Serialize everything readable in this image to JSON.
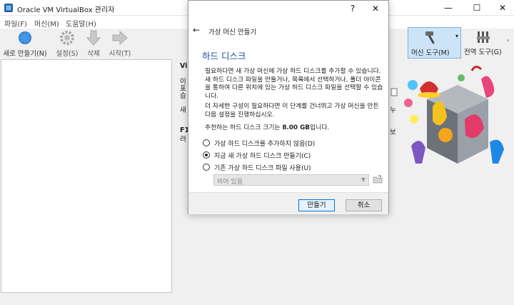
{
  "app": {
    "title": "Oracle VM VirtualBox 관리자"
  },
  "menu": [
    "파일(F)",
    "머신(M)",
    "도움말(H)"
  ],
  "toolbar": {
    "new_label": "새로 만들기(N)",
    "settings_label": "설정(S)",
    "discard_label": "삭제",
    "start_label": "시작(T)",
    "machine_tools_label": "머신 도구(M)",
    "global_tools_label": "전역 도구(G)"
  },
  "background_fragments": {
    "v": "Vi",
    "lines": [
      "이",
      "표",
      "습",
      "새",
      "F1",
      "려"
    ],
    "right": [
      "누",
      "보"
    ]
  },
  "dialog": {
    "title_help": "?",
    "title_close": "✕",
    "wizard_title": "가상 머신 만들기",
    "section_title": "하드 디스크",
    "para1": "필요하다면 새 가상 머신에 가상 하드 디스크를 추가할 수 있습니다. 새 하드 디스크 파일을 만들거나, 목록에서 선택하거나, 폴더 아이콘을 통하여 다른 위치에 있는 가상 하드 디스크 파일을 선택할 수 있습니다.",
    "para2": "더 자세한 구성이 필요하다면 이 단계를 건너뛰고 가상 머신을 만든 다음 설정을 진행하십시오.",
    "recommended_prefix": "추천하는 하드 디스크 크기는 ",
    "recommended_size": "8.00 GB",
    "recommended_suffix": "입니다.",
    "options": [
      {
        "label": "가상 하드 디스크를 추가하지 않음(D)",
        "checked": false
      },
      {
        "label": "지금 새 가상 하드 디스크 만들기(C)",
        "checked": true
      },
      {
        "label": "기존 가상 하드 디스크 파일 사용(U)",
        "checked": false
      }
    ],
    "combo_value": "비어 있음",
    "create_label": "만들기",
    "cancel_label": "취소"
  }
}
